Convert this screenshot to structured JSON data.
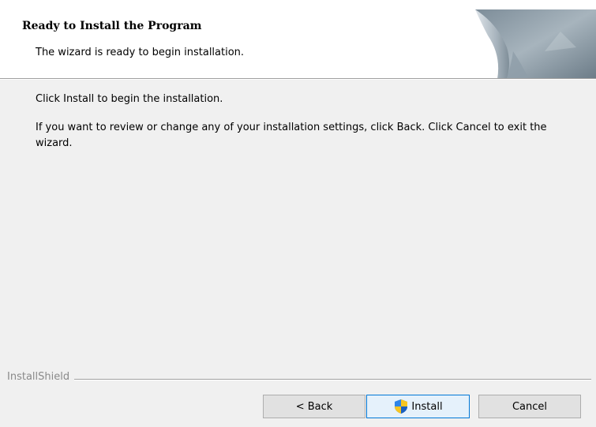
{
  "header": {
    "title": "Ready to Install the Program",
    "subtitle": "The wizard is ready to begin installation."
  },
  "body": {
    "line1": "Click Install to begin the installation.",
    "line2": "If you want to review or change any of your installation settings, click Back. Click Cancel to exit the wizard."
  },
  "footer": {
    "brand": "InstallShield"
  },
  "buttons": {
    "back": "< Back",
    "install": "Install",
    "cancel": "Cancel"
  },
  "icons": {
    "install_button_icon": "uac-shield-icon"
  },
  "colors": {
    "focus_border": "#0078d7",
    "focus_fill": "#e5f1fb",
    "header_bg": "#ffffff",
    "dialog_bg": "#f0f0f0"
  }
}
